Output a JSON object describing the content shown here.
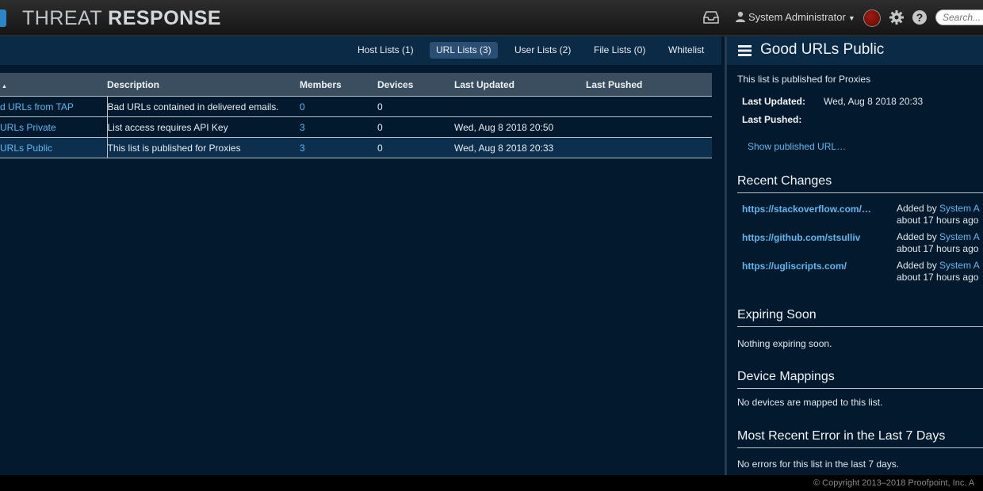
{
  "header": {
    "brand_light": "THREAT ",
    "brand_bold": "RESPONSE",
    "user_name": "System Administrator",
    "search_placeholder": "Search...",
    "status_color": "#8b1409"
  },
  "tabs": [
    {
      "label": "Host Lists (1)",
      "active": false
    },
    {
      "label": "URL Lists (3)",
      "active": true
    },
    {
      "label": "User Lists (2)",
      "active": false
    },
    {
      "label": "File Lists (0)",
      "active": false
    },
    {
      "label": "Whitelist",
      "active": false
    }
  ],
  "table": {
    "sort_indicator": "▲",
    "columns": [
      "Description",
      "Members",
      "Devices",
      "Last Updated",
      "Last Pushed"
    ],
    "rows": [
      {
        "name": "d URLs from TAP",
        "description": "Bad URLs contained in delivered emails.",
        "members": "0",
        "devices": "0",
        "last_updated": "",
        "last_pushed": ""
      },
      {
        "name": "URLs Private",
        "description": "List access requires API Key",
        "members": "3",
        "devices": "0",
        "last_updated": "Wed, Aug 8 2018 20:50",
        "last_pushed": ""
      },
      {
        "name": "URLs Public",
        "description": "This list is published for Proxies",
        "members": "3",
        "devices": "0",
        "last_updated": "Wed, Aug 8 2018 20:33",
        "last_pushed": ""
      }
    ]
  },
  "panel": {
    "title": "Good URLs Public",
    "description": "This list is published for Proxies",
    "last_updated_label": "Last Updated:",
    "last_updated_value": "Wed, Aug 8 2018 20:33",
    "last_pushed_label": "Last Pushed:",
    "show_url_link": "Show published URL…",
    "recent_changes_title": "Recent Changes",
    "changes": [
      {
        "url": "https://stackoverflow.com/…",
        "action": "Added by ",
        "who": "System A",
        "when": "about 17 hours ago"
      },
      {
        "url": "https://github.com/stsulliv",
        "action": "Added by ",
        "who": "System A",
        "when": "about 17 hours ago"
      },
      {
        "url": "https://ugliscripts.com/",
        "action": "Added by ",
        "who": "System A",
        "when": "about 17 hours ago"
      }
    ],
    "expiring_title": "Expiring Soon",
    "expiring_text": "Nothing expiring soon.",
    "device_title": "Device Mappings",
    "device_text": "No devices are mapped to this list.",
    "error_title": "Most Recent Error in the Last 7 Days",
    "error_text": "No errors for this list in the last 7 days."
  },
  "footer": {
    "copyright": "© Copyright 2013–2018 Proofpoint, Inc. A"
  }
}
